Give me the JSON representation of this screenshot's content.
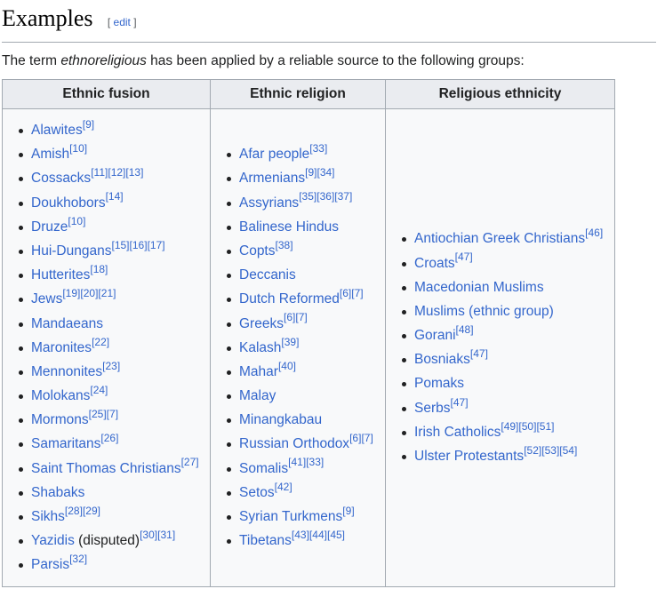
{
  "section": {
    "title": "Examples",
    "edit_label": "edit"
  },
  "intro": {
    "before": "The term ",
    "term": "ethnoreligious",
    "after": " has been applied by a reliable source to the following groups:"
  },
  "table": {
    "headers": [
      "Ethnic fusion",
      "Ethnic religion",
      "Religious ethnicity"
    ],
    "columns": [
      [
        {
          "name": "Alawites",
          "refs": [
            "9"
          ]
        },
        {
          "name": "Amish",
          "refs": [
            "10"
          ]
        },
        {
          "name": "Cossacks",
          "refs": [
            "11",
            "12",
            "13"
          ]
        },
        {
          "name": "Doukhobors",
          "refs": [
            "14"
          ]
        },
        {
          "name": "Druze",
          "refs": [
            "10"
          ]
        },
        {
          "name": "Hui-Dungans",
          "refs": [
            "15",
            "16",
            "17"
          ]
        },
        {
          "name": "Hutterites",
          "refs": [
            "18"
          ]
        },
        {
          "name": "Jews",
          "refs": [
            "19",
            "20",
            "21"
          ]
        },
        {
          "name": "Mandaeans",
          "refs": []
        },
        {
          "name": "Maronites",
          "refs": [
            "22"
          ]
        },
        {
          "name": "Mennonites",
          "refs": [
            "23"
          ]
        },
        {
          "name": "Molokans",
          "refs": [
            "24"
          ]
        },
        {
          "name": "Mormons",
          "refs": [
            "25",
            "7"
          ]
        },
        {
          "name": "Samaritans",
          "refs": [
            "26"
          ]
        },
        {
          "name": "Saint Thomas Christians",
          "refs": [
            "27"
          ]
        },
        {
          "name": "Shabaks",
          "refs": []
        },
        {
          "name": "Sikhs",
          "refs": [
            "28",
            "29"
          ]
        },
        {
          "name": "Yazidis",
          "note": " (disputed)",
          "refs": [
            "30",
            "31"
          ]
        },
        {
          "name": "Parsis",
          "refs": [
            "32"
          ]
        }
      ],
      [
        {
          "name": "Afar people",
          "refs": [
            "33"
          ]
        },
        {
          "name": "Armenians",
          "refs": [
            "9",
            "34"
          ]
        },
        {
          "name": "Assyrians",
          "refs": [
            "35",
            "36",
            "37"
          ]
        },
        {
          "name": "Balinese Hindus",
          "refs": []
        },
        {
          "name": "Copts",
          "refs": [
            "38"
          ]
        },
        {
          "name": "Deccanis",
          "refs": []
        },
        {
          "name": "Dutch Reformed",
          "refs": [
            "6",
            "7"
          ]
        },
        {
          "name": "Greeks",
          "refs": [
            "6",
            "7"
          ]
        },
        {
          "name": "Kalash",
          "refs": [
            "39"
          ]
        },
        {
          "name": "Mahar",
          "refs": [
            "40"
          ]
        },
        {
          "name": "Malay",
          "refs": []
        },
        {
          "name": "Minangkabau",
          "refs": []
        },
        {
          "name": "Russian Orthodox",
          "refs": [
            "6",
            "7"
          ]
        },
        {
          "name": "Somalis",
          "refs": [
            "41",
            "33"
          ]
        },
        {
          "name": "Setos",
          "refs": [
            "42"
          ]
        },
        {
          "name": "Syrian Turkmens",
          "refs": [
            "9"
          ]
        },
        {
          "name": "Tibetans",
          "refs": [
            "43",
            "44",
            "45"
          ]
        }
      ],
      [
        {
          "name": "Antiochian Greek Christians",
          "refs": [
            "46"
          ]
        },
        {
          "name": "Croats",
          "refs": [
            "47"
          ]
        },
        {
          "name": "Macedonian Muslims",
          "refs": []
        },
        {
          "name": "Muslims (ethnic group)",
          "refs": []
        },
        {
          "name": "Gorani",
          "refs": [
            "48"
          ]
        },
        {
          "name": "Bosniaks",
          "refs": [
            "47"
          ]
        },
        {
          "name": "Pomaks",
          "refs": []
        },
        {
          "name": "Serbs",
          "refs": [
            "47"
          ]
        },
        {
          "name": "Irish Catholics",
          "refs": [
            "49",
            "50",
            "51"
          ]
        },
        {
          "name": "Ulster Protestants",
          "refs": [
            "52",
            "53",
            "54"
          ]
        }
      ]
    ]
  }
}
